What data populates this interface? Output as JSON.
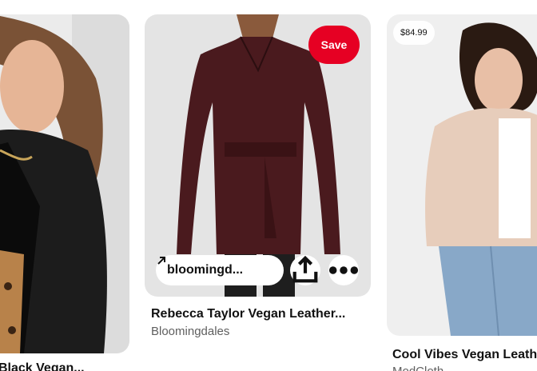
{
  "pins": [
    {
      "title": "Black Vegan...",
      "subtitle": ""
    },
    {
      "title": "Rebecca Taylor Vegan Leather...",
      "subtitle": "Bloomingdales",
      "save_label": "Save",
      "link_label": "bloomingd...",
      "actions": {
        "share_icon": "share-icon",
        "more_icon": "more-icon"
      }
    },
    {
      "title": "Cool Vibes Vegan Leather...",
      "subtitle": "ModCloth",
      "price": "$84.99"
    }
  ],
  "colors": {
    "save_button": "#e60023",
    "subtitle_text": "#5f5f5f",
    "image_placeholder_bg": "#e9e9e9"
  }
}
